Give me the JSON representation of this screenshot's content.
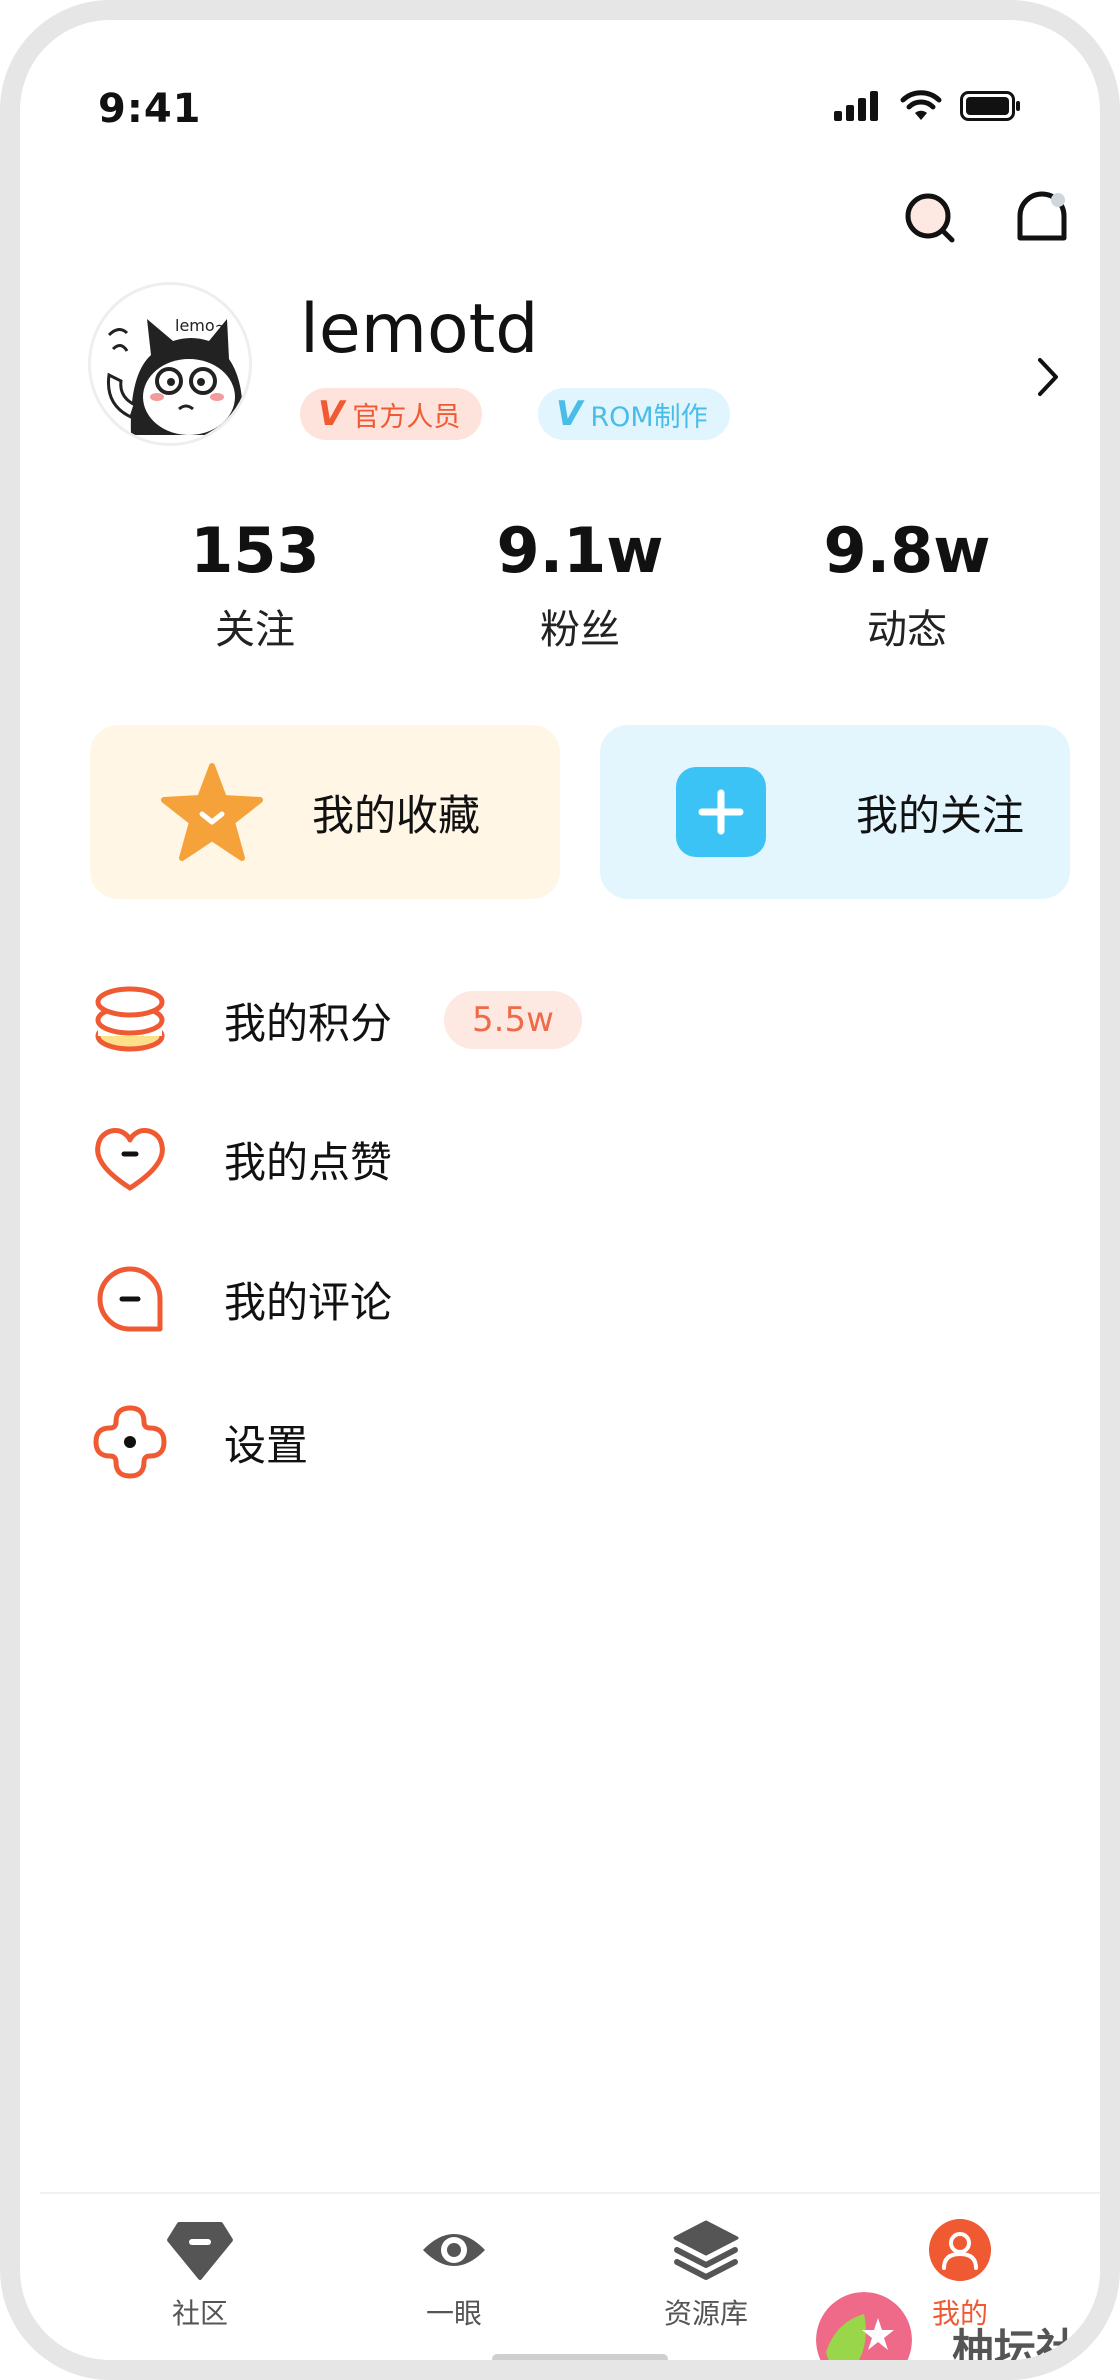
{
  "status_bar": {
    "time": "9:41"
  },
  "profile": {
    "username": "lemotd",
    "badges": [
      {
        "mark": "V",
        "label": "官方人员"
      },
      {
        "mark": "V",
        "label": "ROM制作"
      }
    ]
  },
  "stats": [
    {
      "value": "153",
      "label": "关注"
    },
    {
      "value": "9.1w",
      "label": "粉丝"
    },
    {
      "value": "9.8w",
      "label": "动态"
    }
  ],
  "cards": {
    "favorites": "我的收藏",
    "follows": "我的关注"
  },
  "menu": {
    "points": {
      "label": "我的积分",
      "badge": "5.5w"
    },
    "likes": {
      "label": "我的点赞"
    },
    "comments": {
      "label": "我的评论"
    },
    "settings": {
      "label": "设置"
    }
  },
  "bottom_nav": [
    {
      "label": "社区",
      "icon": "diamond-icon"
    },
    {
      "label": "一眼",
      "icon": "eye-icon"
    },
    {
      "label": "资源库",
      "icon": "layers-icon"
    },
    {
      "label": "我的",
      "icon": "user-icon",
      "active": true
    }
  ],
  "watermark": {
    "text": "柚坛社区"
  },
  "colors": {
    "accent": "#ef5a33",
    "blue": "#3cc3f5",
    "orange": "#f6a23a"
  }
}
